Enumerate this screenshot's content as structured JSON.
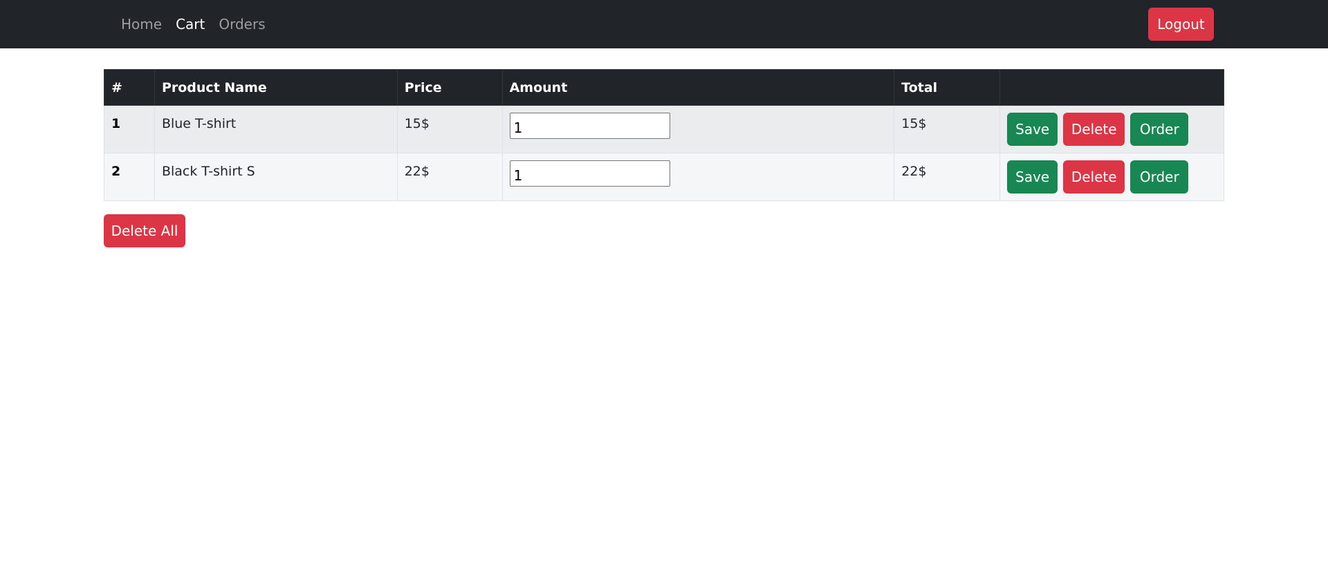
{
  "nav": {
    "links": [
      {
        "label": "Home",
        "active": false
      },
      {
        "label": "Cart",
        "active": true
      },
      {
        "label": "Orders",
        "active": false
      }
    ],
    "logout_label": "Logout"
  },
  "table": {
    "headers": [
      "#",
      "Product Name",
      "Price",
      "Amount",
      "Total",
      ""
    ],
    "rows": [
      {
        "index": "1",
        "product": "Blue T-shirt",
        "price": "15$",
        "amount": "1",
        "total": "15$"
      },
      {
        "index": "2",
        "product": "Black T-shirt S",
        "price": "22$",
        "amount": "1",
        "total": "22$"
      }
    ],
    "actions": {
      "save": "Save",
      "delete": "Delete",
      "order": "Order"
    }
  },
  "delete_all_label": "Delete All",
  "colors": {
    "navbar": "#212529",
    "danger": "#dc3545",
    "success": "#198754"
  }
}
